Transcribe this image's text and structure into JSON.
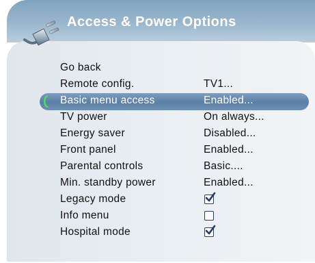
{
  "header": {
    "title": "Access & Power Options"
  },
  "menu": {
    "items": [
      {
        "label": "Go back",
        "value": ""
      },
      {
        "label": "Remote config.",
        "value": "TV1..."
      },
      {
        "label": "Basic menu access",
        "value": "Enabled...",
        "selected": true
      },
      {
        "label": "TV power",
        "value": "On always..."
      },
      {
        "label": "Energy saver",
        "value": "Disabled..."
      },
      {
        "label": "Front panel",
        "value": "Enabled..."
      },
      {
        "label": "Parental controls",
        "value": "Basic...."
      },
      {
        "label": "Min. standby power",
        "value": "Enabled..."
      },
      {
        "label": "Legacy mode",
        "checkbox": "checked"
      },
      {
        "label": "Info menu",
        "checkbox": "unchecked"
      },
      {
        "label": "Hospital mode",
        "checkbox": "checked"
      }
    ]
  },
  "colors": {
    "header": "#8fb0c9",
    "highlight": "#6489b0",
    "panel": "#e6ecf0",
    "cursor": "#4cd964"
  },
  "icons": {
    "header_icon": "power-plug-icon",
    "cursor_icon": "selection-bracket-icon",
    "checkbox_icon": "checkbox-icon"
  }
}
